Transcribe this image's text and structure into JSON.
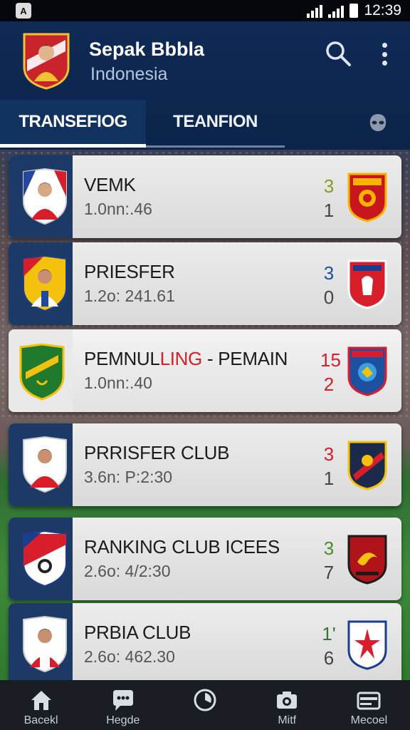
{
  "status_bar": {
    "left_icon": "A",
    "time": "12:39"
  },
  "header": {
    "title": "Sepak Bbbla",
    "subtitle": "Indonesia",
    "tabs": [
      {
        "label": "TRANSEFIOG",
        "active": true
      },
      {
        "label": "TEANFION",
        "active": false
      }
    ]
  },
  "rows": [
    {
      "name": "VEMK",
      "name_highlight": "",
      "name_suffix": "",
      "time": "1.0nn:.46",
      "score_top": "3",
      "score_top_color": "#8a9a2a",
      "score_bottom": "1"
    },
    {
      "name": "PRIESFER",
      "name_highlight": "",
      "name_suffix": "",
      "time": "1.2o: 241.61",
      "score_top": "3",
      "score_top_color": "#1e4fa0",
      "score_bottom": "0"
    },
    {
      "name": "PEMNUL",
      "name_highlight": "LING",
      "name_suffix": " - PEMAIN",
      "time": "1.0nn:.40",
      "score_top": "15",
      "score_top_color": "#d81e2a",
      "score_bottom": "2",
      "score_bottom_color": "#d81e2a"
    },
    {
      "name": "PRRISFER CLUB",
      "name_highlight": "",
      "name_suffix": "",
      "time": "3.6n: P:2:30",
      "score_top": "3",
      "score_top_color": "#d81e2a",
      "score_bottom": "1"
    },
    {
      "name": "RANKING CLUB ICEES",
      "name_highlight": "",
      "name_suffix": "",
      "time": "2.6o: 4/2:30",
      "score_top": "3",
      "score_top_color": "#4f8a2a",
      "score_bottom": "7"
    },
    {
      "name": "PRBIA CLUB",
      "name_highlight": "",
      "name_suffix": "",
      "time": "2.6o: 462.30",
      "score_top": "1'",
      "score_top_color": "#2f7a30",
      "score_bottom": "6"
    }
  ],
  "bottom_nav": [
    {
      "label": "Bacekl",
      "icon": "home-icon"
    },
    {
      "label": "Hegde",
      "icon": "chat-icon"
    },
    {
      "label": "",
      "icon": "clock-icon"
    },
    {
      "label": "Mitf",
      "icon": "camera-icon"
    },
    {
      "label": "Mecoel",
      "icon": "wallet-icon"
    }
  ],
  "colors": {
    "header_bg": "#0f2a55",
    "accent_red": "#d81e2a",
    "nav_bg": "#1a1d24"
  }
}
